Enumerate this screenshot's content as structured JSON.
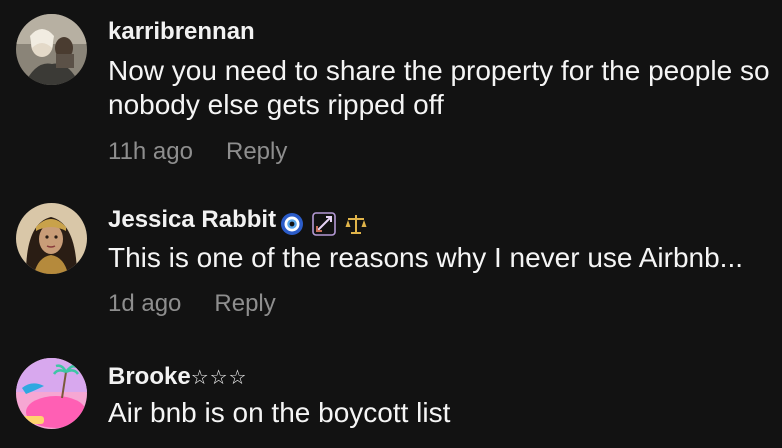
{
  "comments": [
    {
      "username": "karribrennan",
      "text": "Now you need to share the property for the people so nobody else gets ripped off",
      "time": "11h ago",
      "reply_label": "Reply"
    },
    {
      "username": "Jessica Rabbit",
      "badge_icons": [
        "nazar-eye-icon",
        "bow-and-arrow-icon",
        "scales-icon"
      ],
      "text": "This is one of the reasons why I never use Airbnb...",
      "time": "1d ago",
      "reply_label": "Reply"
    },
    {
      "username": "Brooke",
      "username_suffix": "☆☆☆",
      "text": "Air bnb is on the boycott list"
    }
  ]
}
